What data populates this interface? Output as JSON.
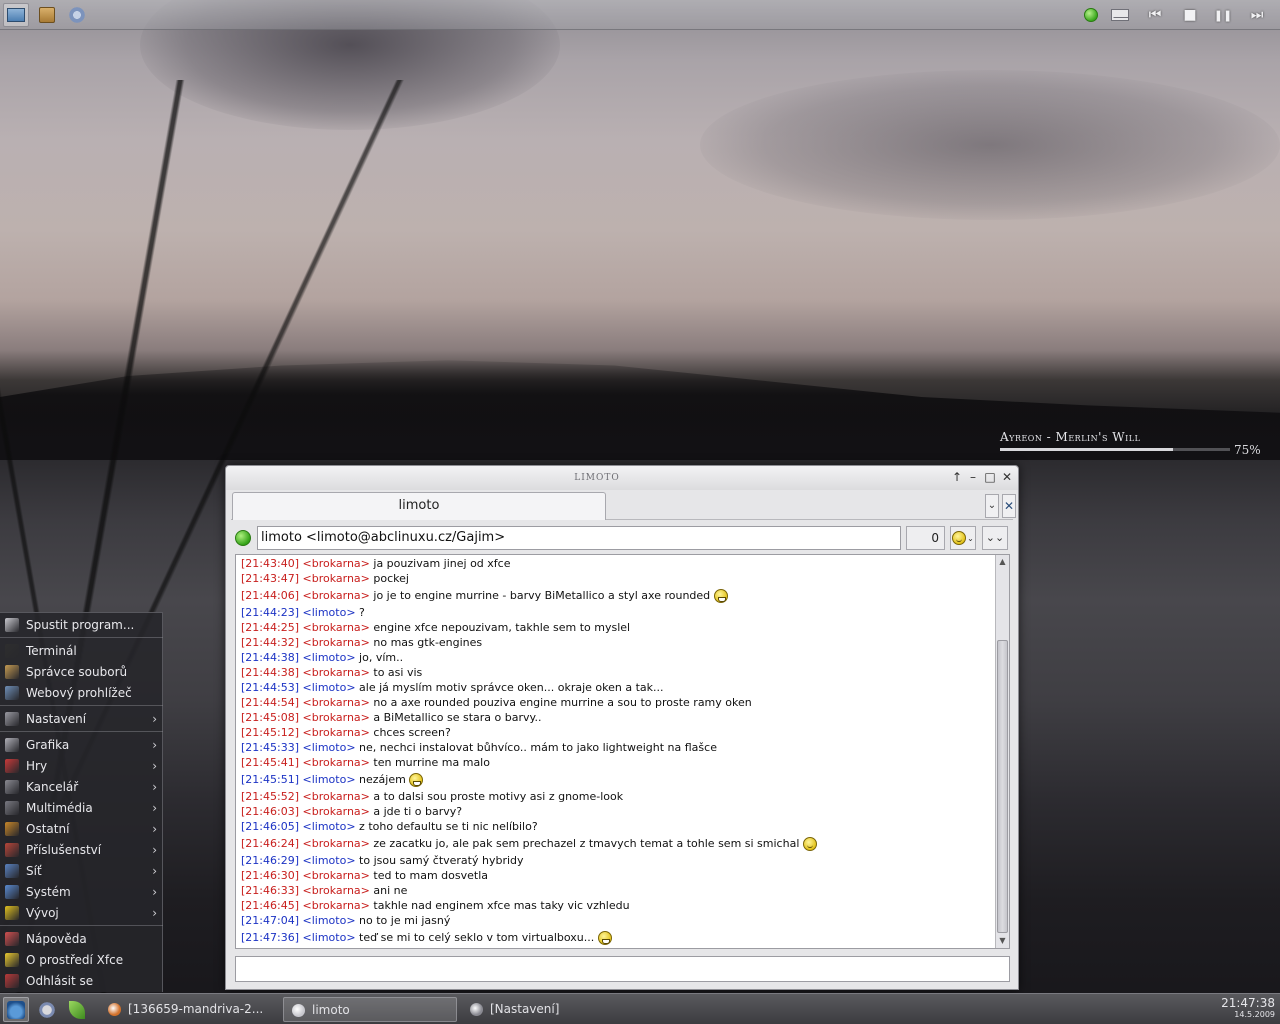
{
  "top_panel": {
    "icons": [
      "desktop-icon",
      "file-manager-icon",
      "settings-gear-icon"
    ],
    "tray_icons": [
      "status-online-icon",
      "mail-icon"
    ],
    "media_controls": {
      "prev": "⏮",
      "stop": "■",
      "pause": "❚❚",
      "next": "⏭"
    }
  },
  "now_playing": {
    "track": "Ayreon - Merlin's Will",
    "percent_label": "75%",
    "progress": 0.75
  },
  "chat_window": {
    "title": "limoto",
    "tab_label": "limoto",
    "tab_dropdown": "⌄",
    "tab_close": "✕",
    "contact": "limoto <limoto@abclinuxu.cz/Gajim>",
    "message_count": "0",
    "menu_button": "⌄⌄",
    "messages": [
      {
        "time": "[21:43:40]",
        "nick": "<brokarna>",
        "who": "b",
        "text": "ja pouzivam jinej od xfce",
        "emoticon": ""
      },
      {
        "time": "[21:43:47]",
        "nick": "<brokarna>",
        "who": "b",
        "text": "pockej",
        "emoticon": ""
      },
      {
        "time": "[21:44:06]",
        "nick": "<brokarna>",
        "who": "b",
        "text": "jo je to engine murrine - barvy BiMetallico a styl axe rounded",
        "emoticon": "grin"
      },
      {
        "time": "[21:44:23]",
        "nick": "<limoto>",
        "who": "l",
        "text": "?",
        "emoticon": ""
      },
      {
        "time": "[21:44:25]",
        "nick": "<brokarna>",
        "who": "b",
        "text": "engine xfce nepouzivam, takhle sem to myslel",
        "emoticon": ""
      },
      {
        "time": "[21:44:32]",
        "nick": "<brokarna>",
        "who": "b",
        "text": "no mas gtk-engines",
        "emoticon": ""
      },
      {
        "time": "[21:44:38]",
        "nick": "<limoto>",
        "who": "l",
        "text": "jo, vím..",
        "emoticon": ""
      },
      {
        "time": "[21:44:38]",
        "nick": "<brokarna>",
        "who": "b",
        "text": "to asi vis",
        "emoticon": ""
      },
      {
        "time": "[21:44:53]",
        "nick": "<limoto>",
        "who": "l",
        "text": "ale já myslím motiv správce oken... okraje oken a tak...",
        "emoticon": ""
      },
      {
        "time": "[21:44:54]",
        "nick": "<brokarna>",
        "who": "b",
        "text": "no a axe rounded pouziva engine murrine a sou to proste ramy oken",
        "emoticon": ""
      },
      {
        "time": "[21:45:08]",
        "nick": "<brokarna>",
        "who": "b",
        "text": "a BiMetallico se stara o barvy..",
        "emoticon": ""
      },
      {
        "time": "[21:45:12]",
        "nick": "<brokarna>",
        "who": "b",
        "text": "chces screen?",
        "emoticon": ""
      },
      {
        "time": "[21:45:33]",
        "nick": "<limoto>",
        "who": "l",
        "text": "ne, nechci instalovat bůhvíco.. mám to jako lightweight na flašce",
        "emoticon": ""
      },
      {
        "time": "[21:45:41]",
        "nick": "<brokarna>",
        "who": "b",
        "text": "ten murrine ma malo",
        "emoticon": ""
      },
      {
        "time": "[21:45:51]",
        "nick": "<limoto>",
        "who": "l",
        "text": "nezájem",
        "emoticon": "grin"
      },
      {
        "time": "[21:45:52]",
        "nick": "<brokarna>",
        "who": "b",
        "text": "a to dalsi sou proste motivy asi z gnome-look",
        "emoticon": ""
      },
      {
        "time": "[21:46:03]",
        "nick": "<brokarna>",
        "who": "b",
        "text": "a jde ti o barvy?",
        "emoticon": ""
      },
      {
        "time": "[21:46:05]",
        "nick": "<limoto>",
        "who": "l",
        "text": "z toho defaultu se ti nic nelíbilo?",
        "emoticon": ""
      },
      {
        "time": "[21:46:24]",
        "nick": "<brokarna>",
        "who": "b",
        "text": "ze zacatku jo, ale pak sem prechazel z tmavych temat a tohle sem si smichal",
        "emoticon": "smile"
      },
      {
        "time": "[21:46:29]",
        "nick": "<limoto>",
        "who": "l",
        "text": "to jsou samý čtveratý hybridy",
        "emoticon": ""
      },
      {
        "time": "[21:46:30]",
        "nick": "<brokarna>",
        "who": "b",
        "text": "ted to mam dosvetla",
        "emoticon": ""
      },
      {
        "time": "[21:46:33]",
        "nick": "<brokarna>",
        "who": "b",
        "text": "ani ne",
        "emoticon": ""
      },
      {
        "time": "[21:46:45]",
        "nick": "<brokarna>",
        "who": "b",
        "text": "takhle nad enginem xfce mas taky vic vzhledu",
        "emoticon": ""
      },
      {
        "time": "[21:47:04]",
        "nick": "<limoto>",
        "who": "l",
        "text": "no to je mi jasný",
        "emoticon": ""
      },
      {
        "time": "[21:47:36]",
        "nick": "<limoto>",
        "who": "l",
        "text": "teď se mi to celý seklo v tom virtualboxu...",
        "emoticon": "grin"
      }
    ],
    "input_value": ""
  },
  "start_menu": {
    "items": [
      {
        "label": "Spustit program...",
        "icon": "run-icon",
        "color": "#c9c9cf",
        "submenu": false,
        "group": 0
      },
      {
        "label": "Terminál",
        "icon": "terminal-icon",
        "color": "#2e2e2e",
        "submenu": false,
        "group": 1
      },
      {
        "label": "Správce souborů",
        "icon": "file-manager-icon",
        "color": "#c49a52",
        "submenu": false,
        "group": 1
      },
      {
        "label": "Webový prohlížeč",
        "icon": "web-browser-icon",
        "color": "#6f8fb8",
        "submenu": false,
        "group": 1
      },
      {
        "label": "Nastavení",
        "icon": "settings-icon",
        "color": "#9a9aa2",
        "submenu": true,
        "group": 2
      },
      {
        "label": "Grafika",
        "icon": "graphics-icon",
        "color": "#b0b0b8",
        "submenu": true,
        "group": 3
      },
      {
        "label": "Hry",
        "icon": "games-icon",
        "color": "#c83a3a",
        "submenu": true,
        "group": 3
      },
      {
        "label": "Kancelář",
        "icon": "office-icon",
        "color": "#8a8a92",
        "submenu": true,
        "group": 3
      },
      {
        "label": "Multimédia",
        "icon": "multimedia-icon",
        "color": "#7a7a82",
        "submenu": true,
        "group": 3
      },
      {
        "label": "Ostatní",
        "icon": "other-icon",
        "color": "#c8872a",
        "submenu": true,
        "group": 3
      },
      {
        "label": "Příslušenství",
        "icon": "accessories-icon",
        "color": "#b8463a",
        "submenu": true,
        "group": 3
      },
      {
        "label": "Síť",
        "icon": "network-icon",
        "color": "#5a82c0",
        "submenu": true,
        "group": 3
      },
      {
        "label": "Systém",
        "icon": "system-icon",
        "color": "#5a8ad0",
        "submenu": true,
        "group": 3
      },
      {
        "label": "Vývoj",
        "icon": "development-icon",
        "color": "#e0c020",
        "submenu": true,
        "group": 3
      },
      {
        "label": "Nápověda",
        "icon": "help-icon",
        "color": "#d05050",
        "submenu": false,
        "group": 4
      },
      {
        "label": "O prostředí Xfce",
        "icon": "about-xfce-icon",
        "color": "#e8c830",
        "submenu": false,
        "group": 4
      },
      {
        "label": "Odhlásit se",
        "icon": "logout-icon",
        "color": "#b83a3a",
        "submenu": false,
        "group": 4
      }
    ],
    "arrow": "›"
  },
  "taskbar": {
    "launchers": [
      "xfce-menu-icon",
      "paw-icon",
      "leaf-icon"
    ],
    "tasks": [
      {
        "label": "[136659-mandriva-2...",
        "icon": "firefox-icon",
        "color": "#d2702a",
        "active": false
      },
      {
        "label": "limoto",
        "icon": "gajim-chat-icon",
        "color": "#c8c8ce",
        "active": true
      },
      {
        "label": "[Nastavení]",
        "icon": "settings-window-icon",
        "color": "#8a8a92",
        "active": false
      }
    ],
    "clock_time": "21:47:38",
    "clock_date": "14.5.2009"
  },
  "colors": {
    "brokarna": "#c8201e",
    "limoto": "#1c33c4"
  }
}
